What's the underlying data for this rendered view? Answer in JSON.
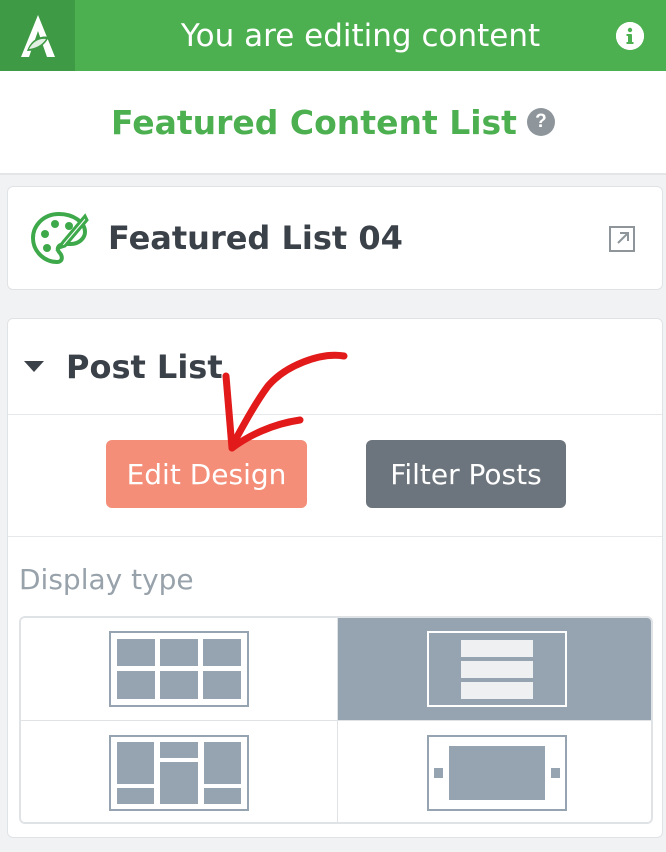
{
  "topbar": {
    "title": "You are editing content",
    "logo_icon": "leaf-a-logo-icon",
    "info_icon": "info-icon",
    "color": "#4caf50"
  },
  "subheader": {
    "title": "Featured Content List",
    "help_icon": "question-icon"
  },
  "featured": {
    "name": "Featured List 04",
    "icon": "palette-icon",
    "link_icon": "external-link-icon"
  },
  "post_list": {
    "title": "Post List",
    "edit_design_label": "Edit Design",
    "filter_posts_label": "Filter Posts",
    "edit_color": "#f48e78",
    "filter_color": "#6c757d",
    "display_type_label": "Display type",
    "display_types": [
      {
        "name": "grid",
        "selected": false
      },
      {
        "name": "list",
        "selected": true
      },
      {
        "name": "masonry",
        "selected": false
      },
      {
        "name": "carousel",
        "selected": false
      }
    ],
    "selected_color": "#96a3b0"
  },
  "annotation": {
    "type": "red-arrow",
    "points_to": "Edit Design",
    "color": "#e21a1a"
  }
}
